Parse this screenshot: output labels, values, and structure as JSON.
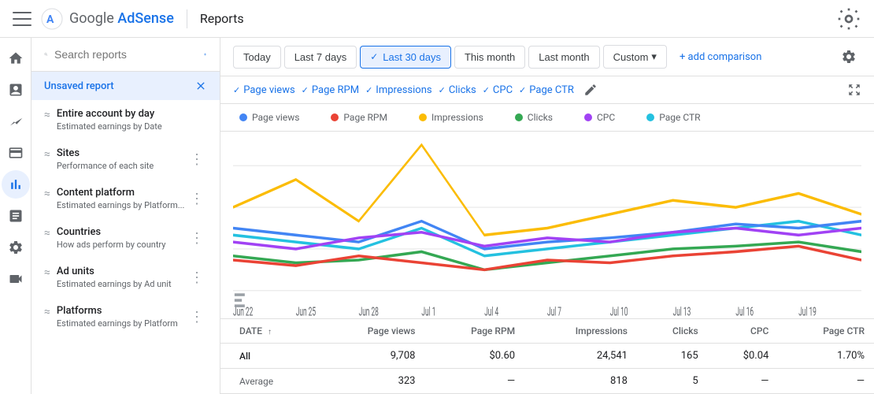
{
  "header": {
    "logo_text": "Google ",
    "logo_brand": "AdSense",
    "nav_title": "Reports",
    "gear_label": "Settings"
  },
  "date_filters": {
    "today": "Today",
    "last_7": "Last 7 days",
    "last_30": "Last 30 days",
    "this_month": "This month",
    "last_month": "Last month",
    "custom": "Custom",
    "add_comparison": "+ add comparison"
  },
  "metrics": {
    "page_views": "Page views",
    "page_rpm": "Page RPM",
    "impressions": "Impressions",
    "clicks": "Clicks",
    "cpc": "CPC",
    "page_ctr": "Page CTR"
  },
  "legend": {
    "page_views_color": "#4285f4",
    "page_rpm_color": "#ea4335",
    "impressions_color": "#fbbc04",
    "clicks_color": "#34a853",
    "cpc_color": "#a142f4",
    "page_ctr_color": "#24c1e0"
  },
  "chart": {
    "x_labels": [
      "Jun 22",
      "Jun 25",
      "Jun 28",
      "Jul 1",
      "Jul 4",
      "Jul 7",
      "Jul 10",
      "Jul 13",
      "Jul 16",
      "Jul 19"
    ]
  },
  "sidebar": {
    "search_placeholder": "Search reports",
    "unsaved_report_label": "Unsaved report",
    "reports": [
      {
        "icon": "≈",
        "name": "Entire account by day",
        "desc": "Estimated earnings by Date"
      },
      {
        "icon": "≈",
        "name": "Sites",
        "desc": "Performance of each site"
      },
      {
        "icon": "≈",
        "name": "Content platform",
        "desc": "Estimated earnings by Platform..."
      },
      {
        "icon": "≈",
        "name": "Countries",
        "desc": "How ads perform by country"
      },
      {
        "icon": "≈",
        "name": "Ad units",
        "desc": "Estimated earnings by Ad unit"
      },
      {
        "icon": "≈",
        "name": "Platforms",
        "desc": "Estimated earnings by Platform"
      }
    ]
  },
  "table": {
    "columns": [
      "DATE",
      "Page views",
      "Page RPM",
      "Impressions",
      "Clicks",
      "CPC",
      "Page CTR"
    ],
    "rows": [
      {
        "label": "All",
        "page_views": "9,708",
        "page_rpm": "$0.60",
        "impressions": "24,541",
        "clicks": "165",
        "cpc": "$0.04",
        "page_ctr": "1.70%"
      },
      {
        "label": "Average",
        "page_views": "323",
        "page_rpm": "—",
        "impressions": "818",
        "clicks": "5",
        "cpc": "—",
        "page_ctr": "—"
      }
    ]
  }
}
